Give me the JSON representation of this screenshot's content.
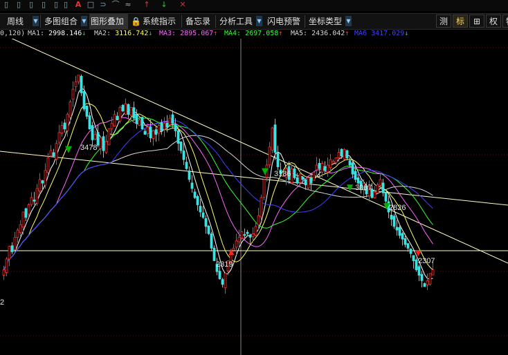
{
  "menu": {
    "items": [
      "周线",
      "多图组合",
      "图形叠加",
      "系统指示",
      "备忘录",
      "分析工具",
      "闪电预警",
      "坐标类型"
    ],
    "right_buttons": [
      "测",
      "标",
      "权",
      "特"
    ]
  },
  "ma_bar": {
    "prefix": "0,120)",
    "items": [
      {
        "label": "MA1:",
        "value": "2998.146",
        "arrow": "↓",
        "color": "#ffffff"
      },
      {
        "label": "MA2:",
        "value": "3116.742",
        "arrow": "↓",
        "color": "#ffff66"
      },
      {
        "label": "MA3:",
        "value": "2895.067",
        "arrow": "↑",
        "color": "#ff66ff"
      },
      {
        "label": "MA4:",
        "value": "2697.058",
        "arrow": "↑",
        "color": "#33ff33"
      },
      {
        "label": "MA5:",
        "value": "2436.042",
        "arrow": "↑",
        "color": "#d8d8d8"
      },
      {
        "label": "MA6",
        "value": "3417.029",
        "arrow": "↓",
        "color": "#4040ff"
      }
    ]
  },
  "chart_data": {
    "type": "candlestick",
    "annotations": [
      "3478",
      "3186",
      "3067",
      "2826",
      "2319",
      "2307",
      "2"
    ],
    "closes": [
      2400,
      2460,
      2530,
      2500,
      2580,
      2620,
      2650,
      2720,
      2690,
      2760,
      2800,
      2780,
      2850,
      2900,
      2880,
      2950,
      3020,
      3060,
      3030,
      3100,
      3160,
      3200,
      3180,
      3260,
      3330,
      3400,
      3440,
      3478,
      3380,
      3290,
      3250,
      3180,
      3120,
      3150,
      3090,
      3130,
      3060,
      3110,
      3180,
      3210,
      3260,
      3230,
      3300,
      3280,
      3320,
      3260,
      3300,
      3240,
      3210,
      3230,
      3180,
      3150,
      3190,
      3130,
      3170,
      3150,
      3200,
      3170,
      3210,
      3190,
      3240,
      3210,
      3170,
      3100,
      3060,
      3010,
      2960,
      2900,
      2850,
      2800,
      2760,
      2720,
      2690,
      2640,
      2600,
      2520,
      2450,
      2390,
      2350,
      2319,
      2380,
      2450,
      2500,
      2520,
      2560,
      2580,
      2610,
      2590,
      2600,
      2580,
      2600,
      2640,
      2700,
      2800,
      2900,
      2980,
      3080,
      3186,
      3050,
      2970,
      2930,
      2920,
      2960,
      2900,
      2960,
      2910,
      2880,
      2930,
      2900,
      2870,
      2910,
      2880,
      2940,
      2980,
      2960,
      2990,
      2950,
      2980,
      3010,
      3000,
      3020,
      3050,
      3030,
      3067,
      3020,
      2980,
      2930,
      2900,
      2880,
      2850,
      2880,
      2820,
      2860,
      2800,
      2830,
      2870,
      2900,
      2826,
      2780,
      2720,
      2680,
      2640,
      2620,
      2590,
      2570,
      2540,
      2520,
      2490,
      2450,
      2400,
      2370,
      2340,
      2307,
      2340,
      2380,
      2400
    ],
    "price_range": [
      2150,
      3680
    ]
  }
}
